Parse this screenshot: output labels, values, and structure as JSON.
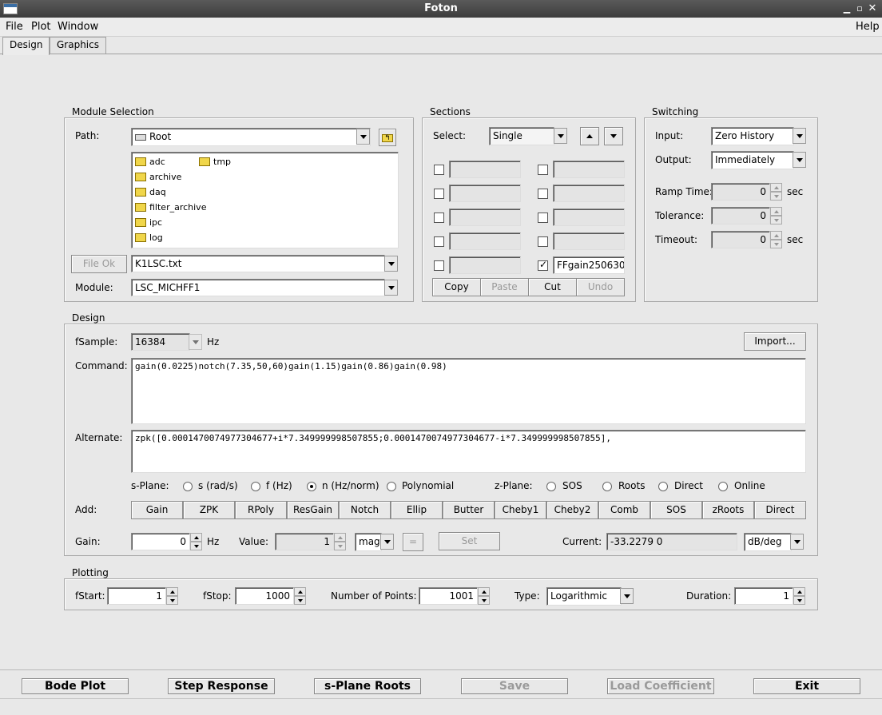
{
  "window": {
    "title": "Foton"
  },
  "menu": {
    "file": "File",
    "plot": "Plot",
    "window": "Window",
    "help": "Help"
  },
  "tabs": {
    "design": "Design",
    "graphics": "Graphics"
  },
  "module_selection": {
    "title": "Module Selection",
    "path_label": "Path:",
    "path_value": "Root",
    "folders": [
      "adc",
      "tmp",
      "archive",
      "daq",
      "filter_archive",
      "ipc",
      "log"
    ],
    "file_ok": "File Ok",
    "file_value": "K1LSC.txt",
    "module_label": "Module:",
    "module_value": "LSC_MICHFF1"
  },
  "sections": {
    "title": "Sections",
    "select_label": "Select:",
    "select_value": "Single",
    "names": [
      "",
      "",
      "",
      "",
      "",
      "",
      "",
      "",
      "",
      "FFgain250630"
    ],
    "checked_index": 9,
    "copy": "Copy",
    "paste": "Paste",
    "cut": "Cut",
    "undo": "Undo"
  },
  "switching": {
    "title": "Switching",
    "input_label": "Input:",
    "input_value": "Zero History",
    "output_label": "Output:",
    "output_value": "Immediately",
    "ramp_label": "Ramp Time:",
    "ramp_value": "0",
    "ramp_unit": "sec",
    "tol_label": "Tolerance:",
    "tol_value": "0",
    "timeout_label": "Timeout:",
    "timeout_value": "0",
    "timeout_unit": "sec"
  },
  "design": {
    "title": "Design",
    "fsample_label": "fSample:",
    "fsample_value": "16384",
    "fsample_unit": "Hz",
    "import": "Import...",
    "command_label": "Command:",
    "command_value": "gain(0.0225)notch(7.35,50,60)gain(1.15)gain(0.86)gain(0.98)",
    "alternate_label": "Alternate:",
    "alternate_value": "zpk([0.0001470074977304677+i*7.349999998507855;0.0001470074977304677-i*7.349999998507855],",
    "splane_label": "s-Plane:",
    "splane_opts": [
      "s (rad/s)",
      "f (Hz)",
      "n (Hz/norm)",
      "Polynomial"
    ],
    "splane_selected": 2,
    "zplane_label": "z-Plane:",
    "zplane_opts": [
      "SOS",
      "Roots",
      "Direct",
      "Online"
    ],
    "add_label": "Add:",
    "add_buttons": [
      "Gain",
      "ZPK",
      "RPoly",
      "ResGain",
      "Notch",
      "Ellip",
      "Butter",
      "Cheby1",
      "Cheby2",
      "Comb",
      "SOS",
      "zRoots",
      "Direct"
    ],
    "gain_label": "Gain:",
    "gain_value": "0",
    "gain_unit": "Hz",
    "value_label": "Value:",
    "value_value": "1",
    "value_mode": "mag",
    "eq": "=",
    "set": "Set",
    "current_label": "Current:",
    "current_value": "-33.2279  0",
    "current_unit": "dB/deg"
  },
  "plotting": {
    "title": "Plotting",
    "fstart_label": "fStart:",
    "fstart_value": "1",
    "fstop_label": "fStop:",
    "fstop_value": "1000",
    "npoints_label": "Number of Points:",
    "npoints_value": "1001",
    "type_label": "Type:",
    "type_value": "Logarithmic",
    "duration_label": "Duration:",
    "duration_value": "1"
  },
  "bottom": {
    "bode": "Bode Plot",
    "step": "Step Response",
    "roots": "s-Plane Roots",
    "save": "Save",
    "load": "Load Coefficient",
    "exit": "Exit"
  }
}
